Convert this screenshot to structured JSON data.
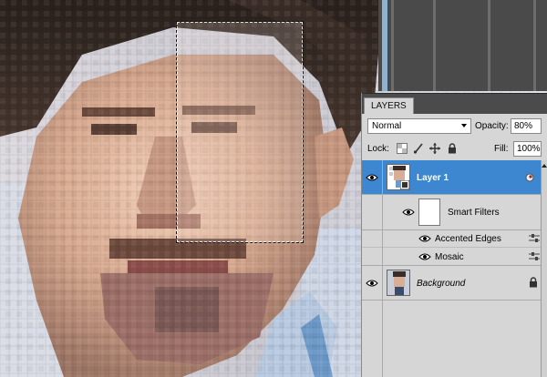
{
  "panel": {
    "tab_label": "LAYERS",
    "blend_mode": "Normal",
    "opacity_label": "Opacity:",
    "opacity_value": "80%",
    "lock_label": "Lock:",
    "fill_label": "Fill:",
    "fill_value": "100%"
  },
  "layers": [
    {
      "name": "Layer 1",
      "selected": true,
      "thumb": "portrait-thumbnail"
    },
    {
      "name": "Smart Filters",
      "thumb": "white-mask"
    },
    {
      "name": "Accented Edges"
    },
    {
      "name": "Mosaic"
    },
    {
      "name": "Background",
      "thumb": "portrait-thumbnail"
    }
  ],
  "colors": {
    "selected_row": "#3c87cf",
    "panel_bg": "#d6d6d6",
    "tab_bar": "#4b4b4b"
  },
  "icons": {
    "visibility": "eye-icon",
    "lock": "lock-icon",
    "smart_object": "smart-object-icon",
    "filter_options": "filter-options-icon"
  }
}
